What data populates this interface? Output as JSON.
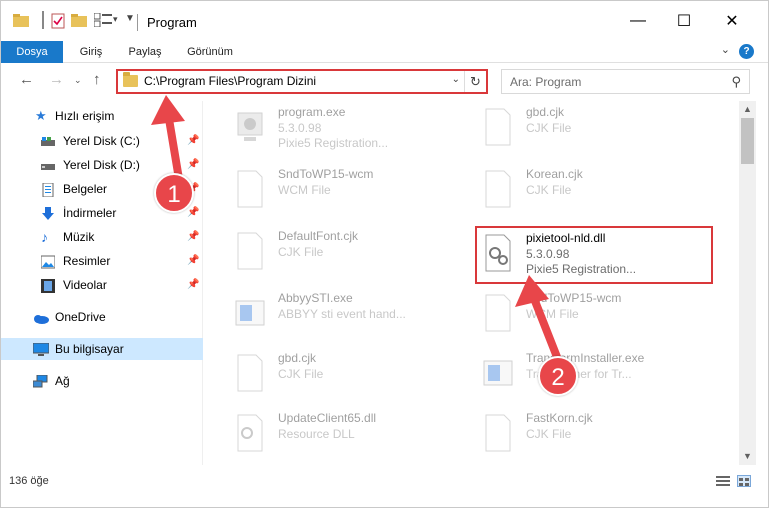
{
  "window": {
    "title": "Program",
    "controls": {
      "minimize": "—",
      "maximize": "☐",
      "close": "✕"
    }
  },
  "ribbon": {
    "tabs": [
      "Dosya",
      "Giriş",
      "Paylaş",
      "Görünüm"
    ]
  },
  "address": {
    "path": "C:\\Program Files\\Program Dizini",
    "search_placeholder": "Ara: Program"
  },
  "sidebar": {
    "quick_access": "Hızlı erişim",
    "items": [
      {
        "label": "Yerel Disk (C:)",
        "icon": "drive-icon",
        "pinned": true
      },
      {
        "label": "Yerel Disk (D:)",
        "icon": "drive-icon",
        "pinned": true
      },
      {
        "label": "Belgeler",
        "icon": "documents-icon",
        "pinned": true
      },
      {
        "label": "İndirmeler",
        "icon": "downloads-icon",
        "pinned": true
      },
      {
        "label": "Müzik",
        "icon": "music-icon",
        "pinned": true
      },
      {
        "label": "Resimler",
        "icon": "pictures-icon",
        "pinned": true
      },
      {
        "label": "Videolar",
        "icon": "videos-icon",
        "pinned": true
      }
    ],
    "onedrive": "OneDrive",
    "this_pc": "Bu bilgisayar",
    "network": "Ağ"
  },
  "files": [
    {
      "name": "program.exe",
      "line1": "5.3.0.98",
      "line2": "Pixie5 Registration...",
      "icon": "exe-icon"
    },
    {
      "name": "gbd.cjk",
      "line1": "CJK File",
      "line2": "",
      "icon": "file-icon"
    },
    {
      "name": "SndToWP15-wcm",
      "line1": "WCM File",
      "line2": "",
      "icon": "file-icon"
    },
    {
      "name": "Korean.cjk",
      "line1": "CJK File",
      "line2": "",
      "icon": "file-icon"
    },
    {
      "name": "DefaultFont.cjk",
      "line1": "CJK File",
      "line2": "",
      "icon": "file-icon"
    },
    {
      "name": "pixietool-nld.dll",
      "line1": "5.3.0.98",
      "line2": "Pixie5 Registration...",
      "icon": "dll-icon"
    },
    {
      "name": "AbbyySTI.exe",
      "line1": "ABBYY sti event hand...",
      "line2": "",
      "icon": "app-icon"
    },
    {
      "name": "SndToWP15-wcm",
      "line1": "WCM File",
      "line2": "",
      "icon": "file-icon"
    },
    {
      "name": "gbd.cjk",
      "line1": "CJK File",
      "line2": "",
      "icon": "file-icon"
    },
    {
      "name": "TransformInstaller.exe",
      "line1": "Transformer for Tr...",
      "line2": "",
      "icon": "app-icon"
    },
    {
      "name": "UpdateClient65.dll",
      "line1": "Resource DLL",
      "line2": "",
      "icon": "dll-icon"
    },
    {
      "name": "FastKorn.cjk",
      "line1": "CJK File",
      "line2": "",
      "icon": "file-icon"
    }
  ],
  "status": {
    "count": "136 öğe"
  },
  "callouts": [
    "1",
    "2"
  ],
  "colors": {
    "accent": "#1979ca",
    "highlight": "#d9383a",
    "callout": "#e8464a",
    "selection": "#cde8ff"
  }
}
